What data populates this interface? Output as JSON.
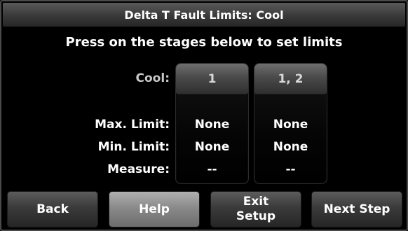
{
  "title": "Delta T Fault Limits: Cool",
  "instruction": "Press on the stages below to set limits",
  "labels": {
    "cool": "Cool:",
    "max_limit": "Max. Limit:",
    "min_limit": "Min. Limit:",
    "measure": "Measure:"
  },
  "stages": [
    {
      "name": "1",
      "max_limit": "None",
      "min_limit": "None",
      "measure": "--"
    },
    {
      "name": "1, 2",
      "max_limit": "None",
      "min_limit": "None",
      "measure": "--"
    }
  ],
  "buttons": {
    "back": "Back",
    "help": "Help",
    "exit_line1": "Exit",
    "exit_line2": "Setup",
    "next": "Next Step"
  }
}
